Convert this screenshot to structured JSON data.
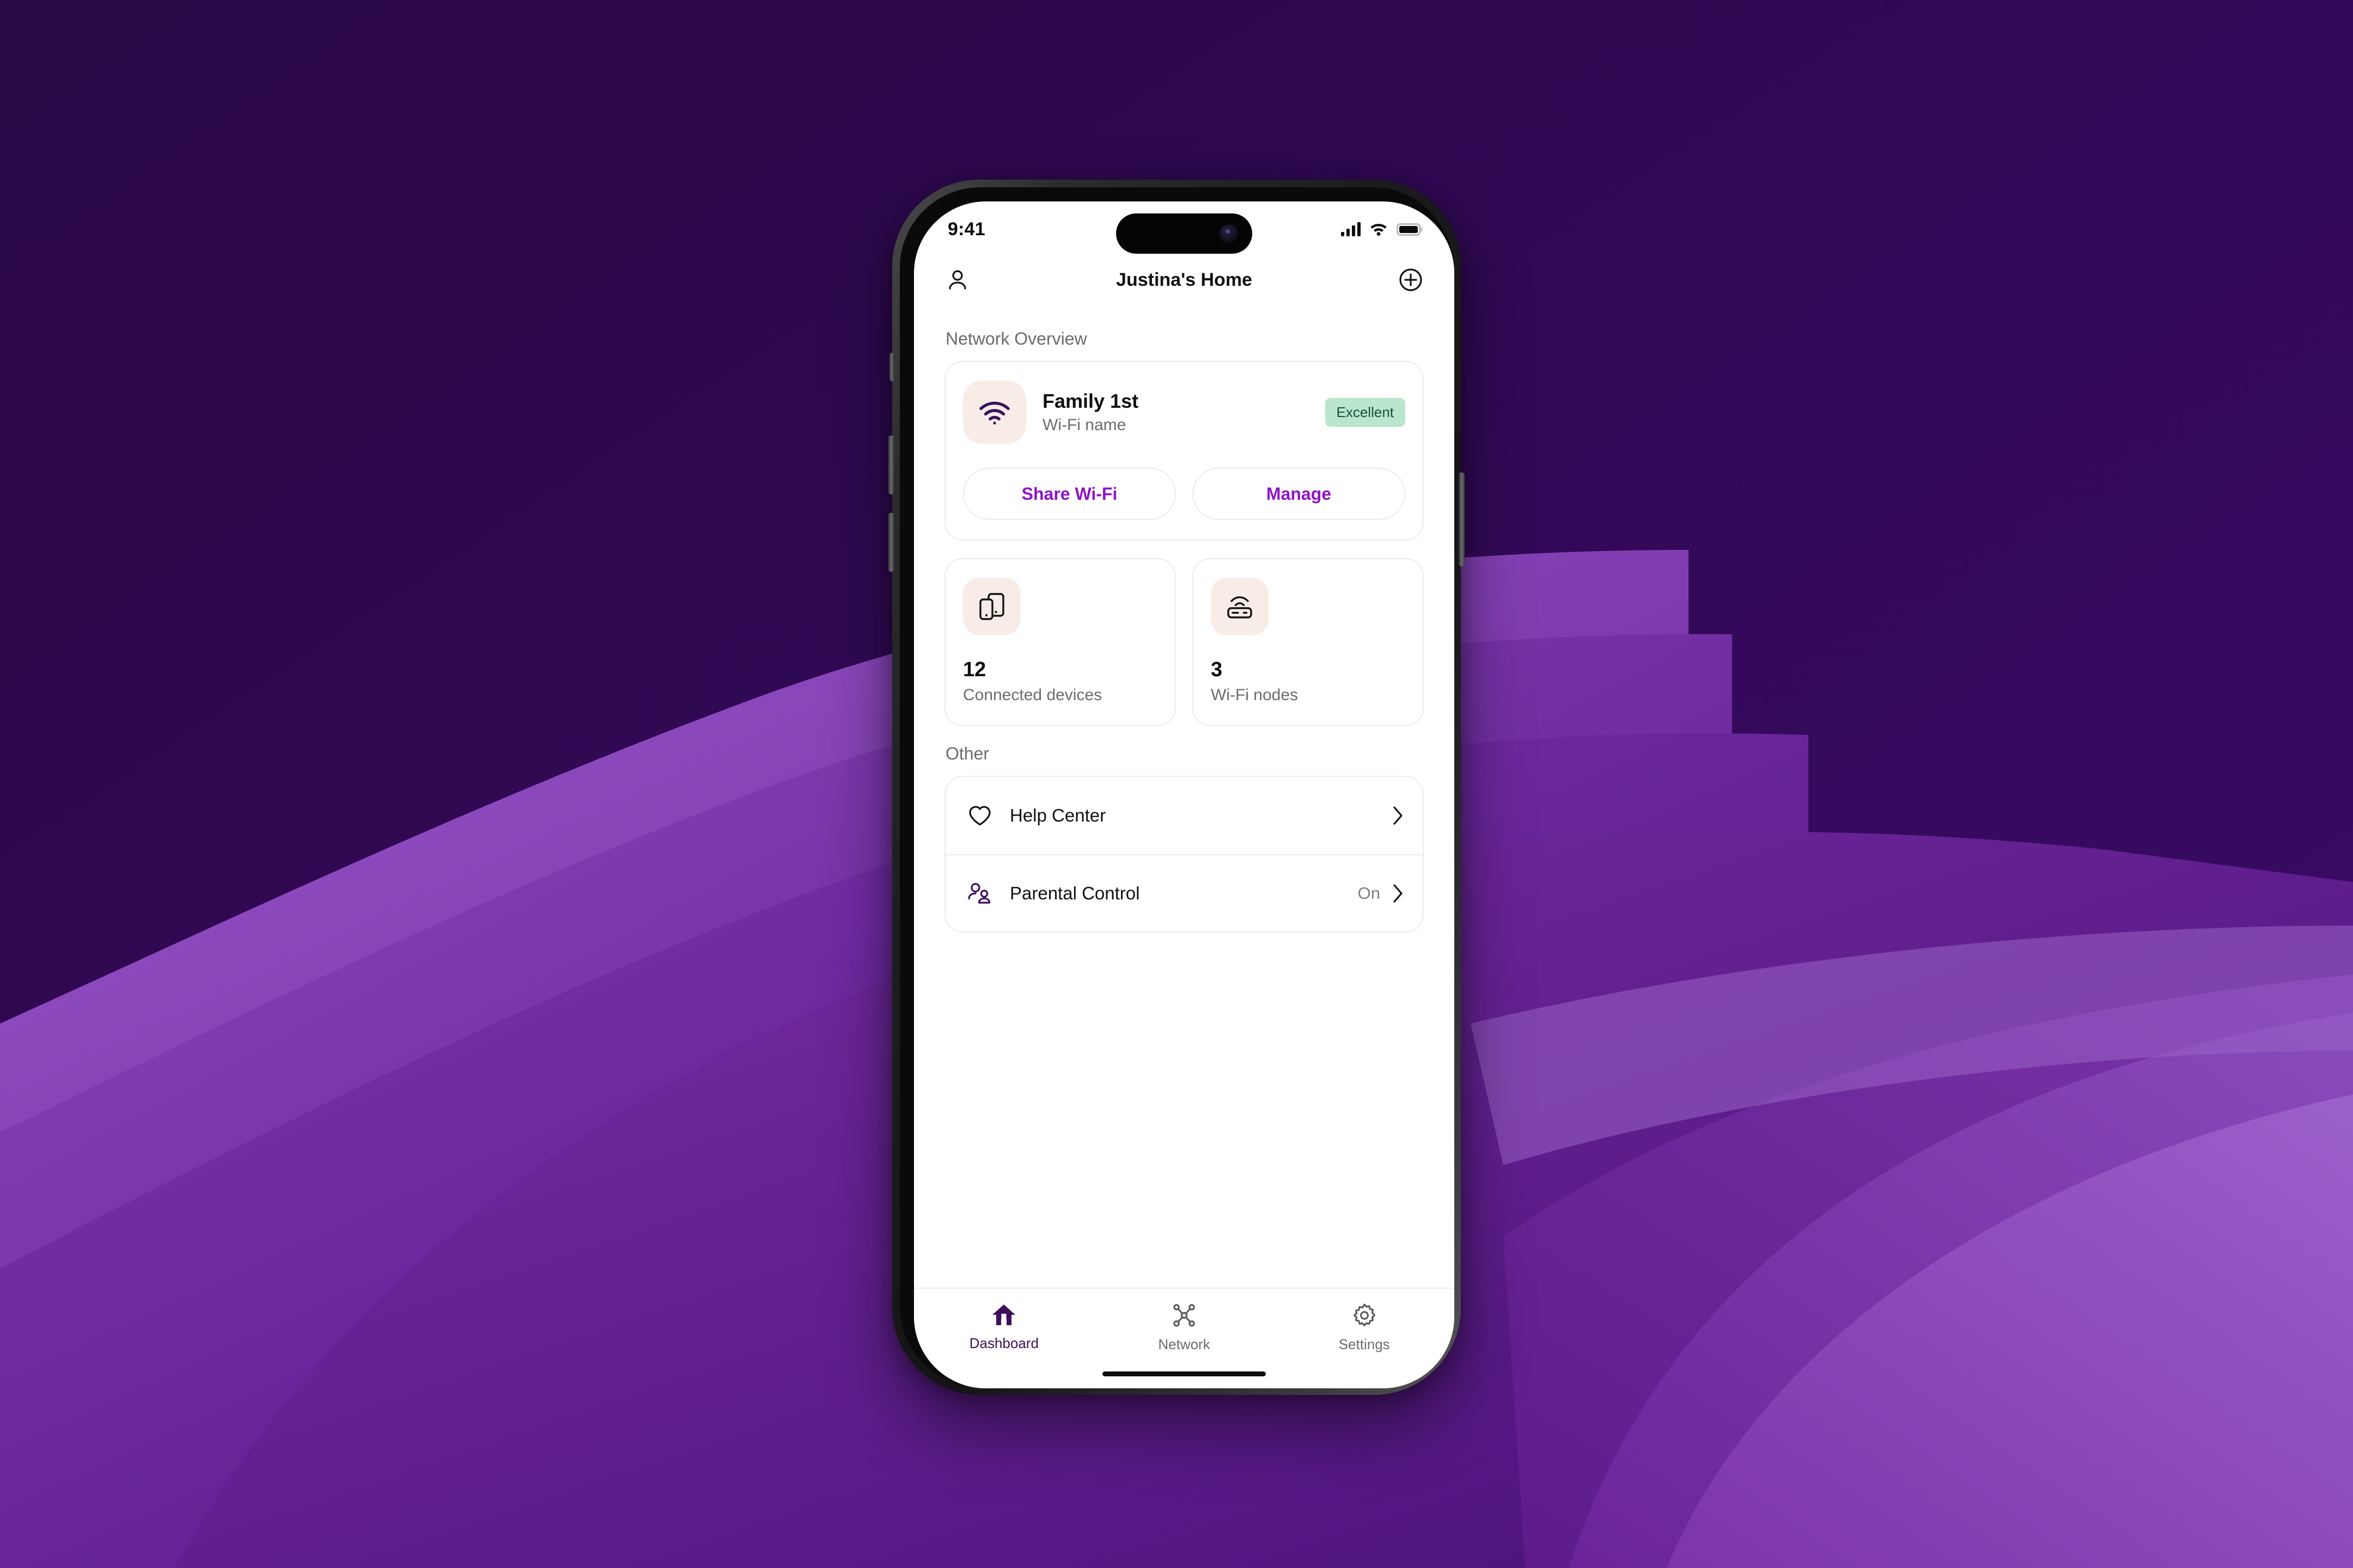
{
  "status_bar": {
    "time": "9:41",
    "cellular_icon": "signal-bars-icon",
    "wifi_icon": "wifi-icon",
    "battery_icon": "battery-full-icon"
  },
  "nav": {
    "title": "Justina's Home",
    "profile_icon": "person-icon",
    "add_icon": "plus-circle-icon"
  },
  "sections": {
    "network_overview_title": "Network Overview",
    "other_title": "Other"
  },
  "wifi_card": {
    "icon": "wifi-icon",
    "name": "Family 1st",
    "subtitle": "Wi-Fi name",
    "status_badge": "Excellent",
    "badge_bg": "#B9E6CC",
    "badge_text_color": "#16543A",
    "share_button": "Share Wi-Fi",
    "manage_button": "Manage"
  },
  "stats": [
    {
      "icon": "devices-icon",
      "value": "12",
      "label": "Connected devices"
    },
    {
      "icon": "router-icon",
      "value": "3",
      "label": "Wi-Fi nodes"
    }
  ],
  "other_list": [
    {
      "icon": "heart-icon",
      "label": "Help Center",
      "value": "",
      "chevron": "chevron-right-icon"
    },
    {
      "icon": "family-icon",
      "label": "Parental Control",
      "value": "On",
      "chevron": "chevron-right-icon"
    }
  ],
  "tabs": [
    {
      "icon": "home-icon",
      "label": "Dashboard",
      "active": true
    },
    {
      "icon": "network-icon",
      "label": "Network",
      "active": false
    },
    {
      "icon": "gear-icon",
      "label": "Settings",
      "active": false
    }
  ],
  "colors": {
    "background_dark_purple": "#2C0A4A",
    "background_wave_purple": "#7A2FA8",
    "accent_purple": "#8F14C8",
    "brand_deep_purple": "#3D0F5C",
    "icon_tile_cream": "#F8EDE6"
  }
}
